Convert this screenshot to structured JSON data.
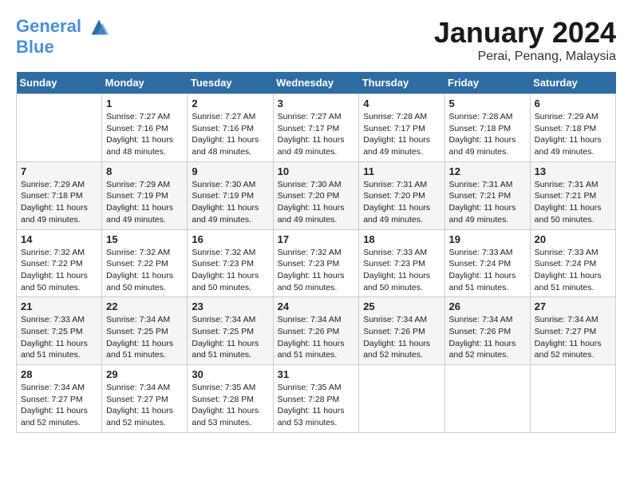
{
  "header": {
    "logo_line1": "General",
    "logo_line2": "Blue",
    "month": "January 2024",
    "location": "Perai, Penang, Malaysia"
  },
  "days_of_week": [
    "Sunday",
    "Monday",
    "Tuesday",
    "Wednesday",
    "Thursday",
    "Friday",
    "Saturday"
  ],
  "weeks": [
    [
      {
        "day": "",
        "info": ""
      },
      {
        "day": "1",
        "info": "Sunrise: 7:27 AM\nSunset: 7:16 PM\nDaylight: 11 hours and 48 minutes."
      },
      {
        "day": "2",
        "info": "Sunrise: 7:27 AM\nSunset: 7:16 PM\nDaylight: 11 hours and 48 minutes."
      },
      {
        "day": "3",
        "info": "Sunrise: 7:27 AM\nSunset: 7:17 PM\nDaylight: 11 hours and 49 minutes."
      },
      {
        "day": "4",
        "info": "Sunrise: 7:28 AM\nSunset: 7:17 PM\nDaylight: 11 hours and 49 minutes."
      },
      {
        "day": "5",
        "info": "Sunrise: 7:28 AM\nSunset: 7:18 PM\nDaylight: 11 hours and 49 minutes."
      },
      {
        "day": "6",
        "info": "Sunrise: 7:29 AM\nSunset: 7:18 PM\nDaylight: 11 hours and 49 minutes."
      }
    ],
    [
      {
        "day": "7",
        "info": "Sunrise: 7:29 AM\nSunset: 7:18 PM\nDaylight: 11 hours and 49 minutes."
      },
      {
        "day": "8",
        "info": "Sunrise: 7:29 AM\nSunset: 7:19 PM\nDaylight: 11 hours and 49 minutes."
      },
      {
        "day": "9",
        "info": "Sunrise: 7:30 AM\nSunset: 7:19 PM\nDaylight: 11 hours and 49 minutes."
      },
      {
        "day": "10",
        "info": "Sunrise: 7:30 AM\nSunset: 7:20 PM\nDaylight: 11 hours and 49 minutes."
      },
      {
        "day": "11",
        "info": "Sunrise: 7:31 AM\nSunset: 7:20 PM\nDaylight: 11 hours and 49 minutes."
      },
      {
        "day": "12",
        "info": "Sunrise: 7:31 AM\nSunset: 7:21 PM\nDaylight: 11 hours and 49 minutes."
      },
      {
        "day": "13",
        "info": "Sunrise: 7:31 AM\nSunset: 7:21 PM\nDaylight: 11 hours and 50 minutes."
      }
    ],
    [
      {
        "day": "14",
        "info": "Sunrise: 7:32 AM\nSunset: 7:22 PM\nDaylight: 11 hours and 50 minutes."
      },
      {
        "day": "15",
        "info": "Sunrise: 7:32 AM\nSunset: 7:22 PM\nDaylight: 11 hours and 50 minutes."
      },
      {
        "day": "16",
        "info": "Sunrise: 7:32 AM\nSunset: 7:23 PM\nDaylight: 11 hours and 50 minutes."
      },
      {
        "day": "17",
        "info": "Sunrise: 7:32 AM\nSunset: 7:23 PM\nDaylight: 11 hours and 50 minutes."
      },
      {
        "day": "18",
        "info": "Sunrise: 7:33 AM\nSunset: 7:23 PM\nDaylight: 11 hours and 50 minutes."
      },
      {
        "day": "19",
        "info": "Sunrise: 7:33 AM\nSunset: 7:24 PM\nDaylight: 11 hours and 51 minutes."
      },
      {
        "day": "20",
        "info": "Sunrise: 7:33 AM\nSunset: 7:24 PM\nDaylight: 11 hours and 51 minutes."
      }
    ],
    [
      {
        "day": "21",
        "info": "Sunrise: 7:33 AM\nSunset: 7:25 PM\nDaylight: 11 hours and 51 minutes."
      },
      {
        "day": "22",
        "info": "Sunrise: 7:34 AM\nSunset: 7:25 PM\nDaylight: 11 hours and 51 minutes."
      },
      {
        "day": "23",
        "info": "Sunrise: 7:34 AM\nSunset: 7:25 PM\nDaylight: 11 hours and 51 minutes."
      },
      {
        "day": "24",
        "info": "Sunrise: 7:34 AM\nSunset: 7:26 PM\nDaylight: 11 hours and 51 minutes."
      },
      {
        "day": "25",
        "info": "Sunrise: 7:34 AM\nSunset: 7:26 PM\nDaylight: 11 hours and 52 minutes."
      },
      {
        "day": "26",
        "info": "Sunrise: 7:34 AM\nSunset: 7:26 PM\nDaylight: 11 hours and 52 minutes."
      },
      {
        "day": "27",
        "info": "Sunrise: 7:34 AM\nSunset: 7:27 PM\nDaylight: 11 hours and 52 minutes."
      }
    ],
    [
      {
        "day": "28",
        "info": "Sunrise: 7:34 AM\nSunset: 7:27 PM\nDaylight: 11 hours and 52 minutes."
      },
      {
        "day": "29",
        "info": "Sunrise: 7:34 AM\nSunset: 7:27 PM\nDaylight: 11 hours and 52 minutes."
      },
      {
        "day": "30",
        "info": "Sunrise: 7:35 AM\nSunset: 7:28 PM\nDaylight: 11 hours and 53 minutes."
      },
      {
        "day": "31",
        "info": "Sunrise: 7:35 AM\nSunset: 7:28 PM\nDaylight: 11 hours and 53 minutes."
      },
      {
        "day": "",
        "info": ""
      },
      {
        "day": "",
        "info": ""
      },
      {
        "day": "",
        "info": ""
      }
    ]
  ]
}
